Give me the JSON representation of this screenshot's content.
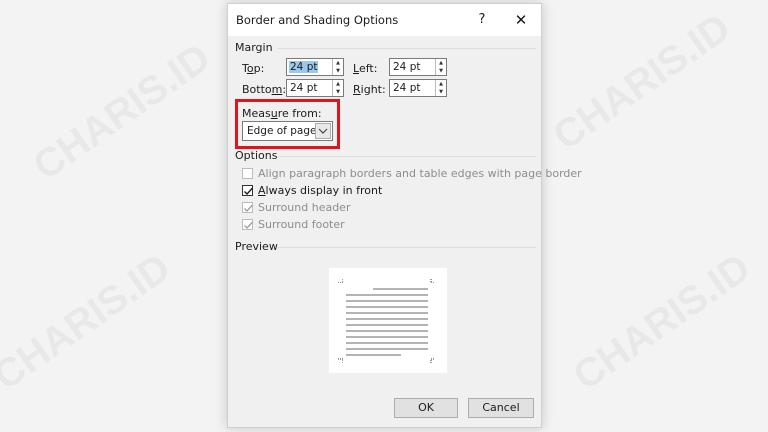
{
  "dialog": {
    "title": "Border and Shading Options",
    "help_label": "?",
    "close_label": "✕"
  },
  "margin": {
    "group_label": "Margin",
    "top": {
      "label_pre": "T",
      "label_u": "o",
      "label_post": "p:",
      "value": "24 pt"
    },
    "bottom": {
      "label_pre": "Botto",
      "label_u": "m",
      "label_post": ":",
      "value": "24 pt"
    },
    "left": {
      "label_pre": "",
      "label_u": "L",
      "label_post": "eft:",
      "value": "24 pt"
    },
    "right": {
      "label_pre": "",
      "label_u": "R",
      "label_post": "ight:",
      "value": "24 pt"
    }
  },
  "measure": {
    "label_pre": "Meas",
    "label_u": "u",
    "label_post": "re from:",
    "selected": "Edge of page",
    "highlight_color": "#e0141a"
  },
  "options": {
    "group_label": "Options",
    "items": [
      {
        "label": "Align paragraph borders and table edges with page border",
        "checked": false,
        "enabled": false
      },
      {
        "label_u": "A",
        "label": "lways display in front",
        "checked": true,
        "enabled": true
      },
      {
        "label": "Surround header",
        "checked": true,
        "enabled": false
      },
      {
        "label": "Surround footer",
        "checked": true,
        "enabled": false
      }
    ]
  },
  "preview": {
    "group_label": "Preview"
  },
  "buttons": {
    "ok": "OK",
    "cancel": "Cancel"
  },
  "watermark": "CHARIS.ID"
}
